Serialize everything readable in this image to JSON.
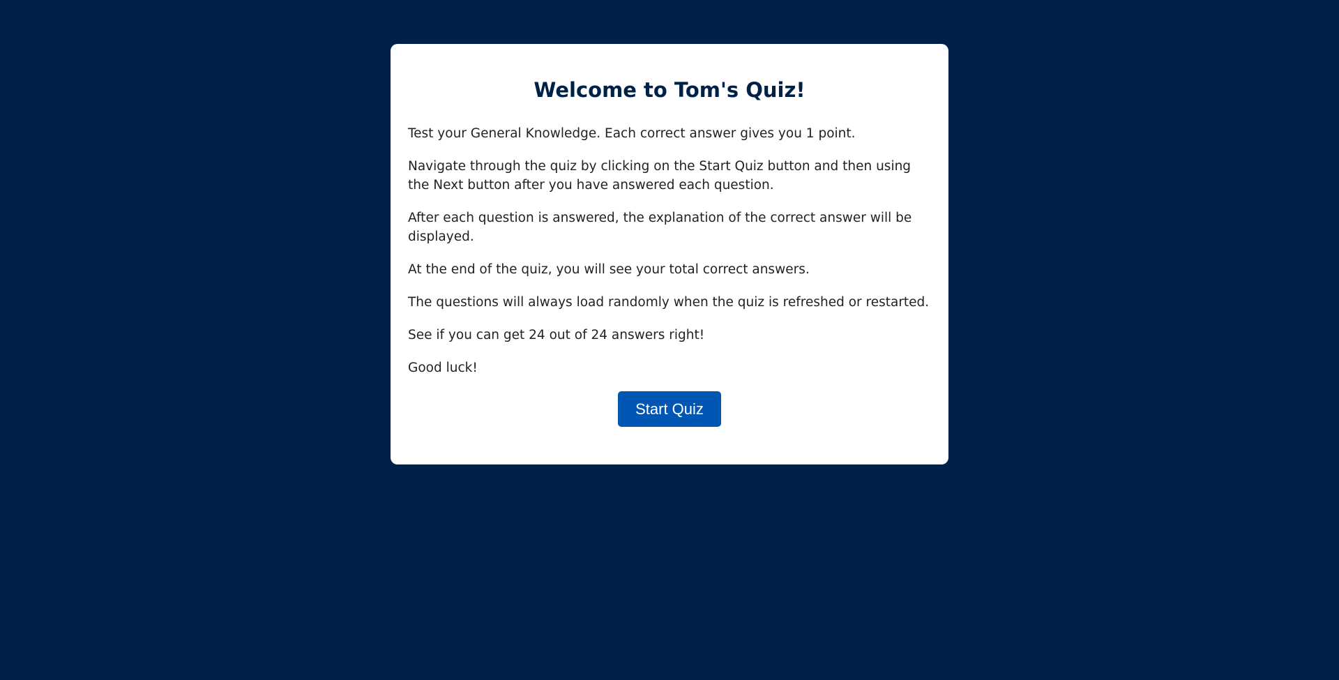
{
  "welcome": {
    "title": "Welcome to Tom's Quiz!",
    "paragraphs": [
      "Test your General Knowledge. Each correct answer gives you 1 point.",
      "Navigate through the quiz by clicking on the Start Quiz button and then using the Next button after you have answered each question.",
      "After each question is answered, the explanation of the correct answer will be displayed.",
      "At the end of the quiz, you will see your total correct answers.",
      "The questions will always load randomly when the quiz is refreshed or restarted.",
      "See if you can get 24 out of 24 answers right!",
      "Good luck!"
    ],
    "start_label": "Start Quiz"
  },
  "colors": {
    "background": "#002147",
    "card": "#ffffff",
    "title": "#002147",
    "button": "#0056b3",
    "button_text": "#ffffff"
  }
}
